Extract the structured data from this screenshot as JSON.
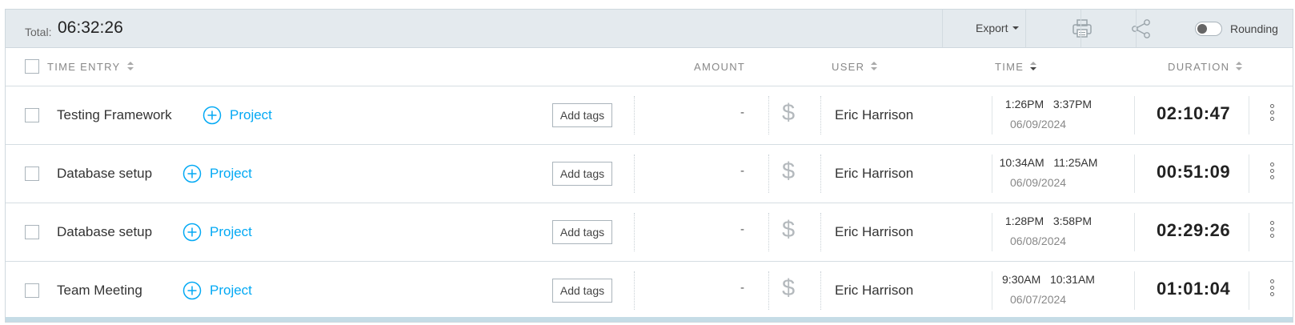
{
  "summary": {
    "total_label": "Total:",
    "total_value": "06:32:26"
  },
  "toolbar": {
    "export_label": "Export",
    "print_icon": "printer-icon",
    "share_icon": "share-icon",
    "rounding_label": "Rounding",
    "rounding_enabled": false
  },
  "columns": {
    "time_entry": "TIME ENTRY",
    "amount": "AMOUNT",
    "user": "USER",
    "time": "TIME",
    "duration": "DURATION"
  },
  "entries": [
    {
      "description": "Testing Framework",
      "project_label": "Project",
      "tags_label": "Add tags",
      "amount": "-",
      "billable_icon": "$",
      "user": "Eric Harrison",
      "start": "1:26PM",
      "end": "3:37PM",
      "date": "06/09/2024",
      "duration": "02:10:47"
    },
    {
      "description": "Database setup",
      "project_label": "Project",
      "tags_label": "Add tags",
      "amount": "-",
      "billable_icon": "$",
      "user": "Eric Harrison",
      "start": "10:34AM",
      "end": "11:25AM",
      "date": "06/09/2024",
      "duration": "00:51:09"
    },
    {
      "description": "Database setup",
      "project_label": "Project",
      "tags_label": "Add tags",
      "amount": "-",
      "billable_icon": "$",
      "user": "Eric Harrison",
      "start": "1:28PM",
      "end": "3:58PM",
      "date": "06/08/2024",
      "duration": "02:29:26"
    },
    {
      "description": "Team Meeting",
      "project_label": "Project",
      "tags_label": "Add tags",
      "amount": "-",
      "billable_icon": "$",
      "user": "Eric Harrison",
      "start": "9:30AM",
      "end": "10:31AM",
      "date": "06/07/2024",
      "duration": "01:01:04"
    }
  ],
  "colors": {
    "accent": "#03a9f4",
    "toolbar_bg": "#e4eaee"
  }
}
